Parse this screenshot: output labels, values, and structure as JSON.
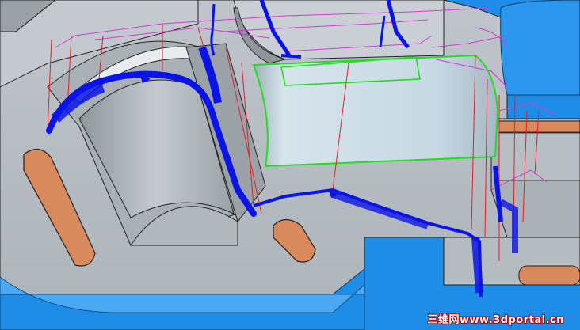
{
  "viewport": {
    "watermark_text": "三维网www.3dportal.cn"
  },
  "colors": {
    "background_blue": "#1e8de8",
    "model_gray": "#b7bec5",
    "model_light": "#d2d8dc",
    "model_dark": "#8c949b",
    "cylinder_face": "#c8dde8",
    "slot_orange": "#d88a5c",
    "toolpath_blue": "#0a14e6",
    "plunge_red": "#e0202a",
    "retract_magenta": "#d23cd2",
    "selection_green": "#22dd22",
    "edge_black": "#1a1a1a"
  },
  "icons": {
    "toolpath": "toolpath-icon",
    "selection": "selection-outline-icon"
  }
}
